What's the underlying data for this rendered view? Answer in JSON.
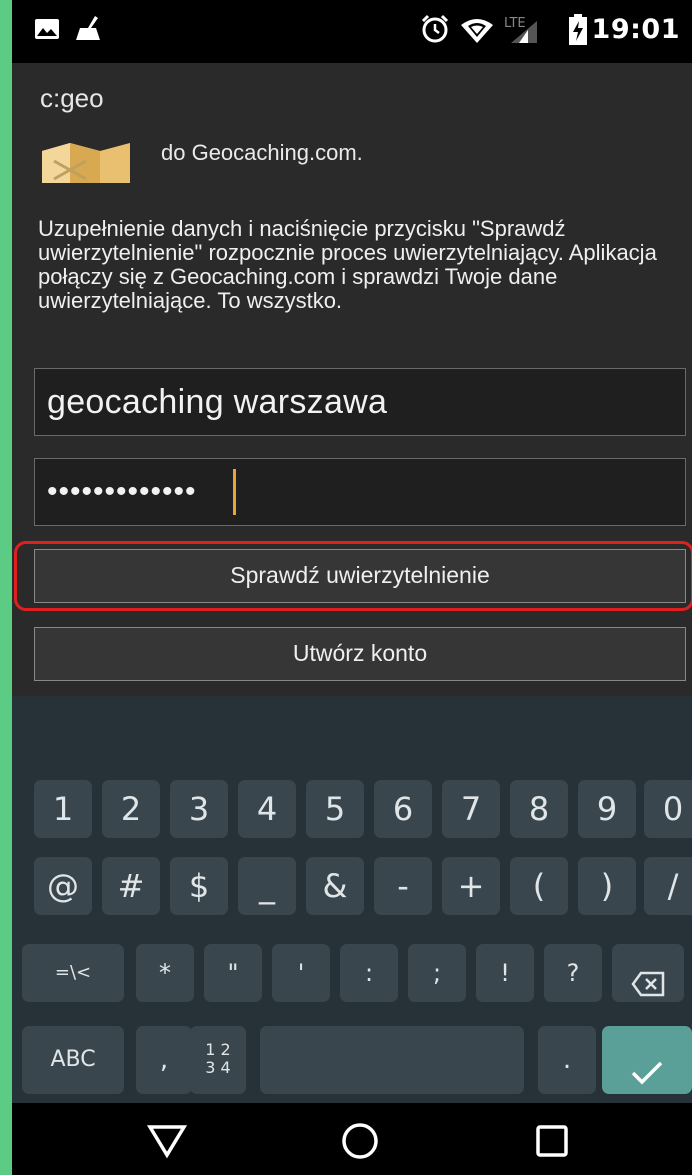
{
  "status_bar": {
    "time": "19:01",
    "network_label": "LTE",
    "left_icons": [
      "image-icon",
      "cleanup-icon"
    ],
    "right_icons": [
      "alarm-icon",
      "wifi-icon",
      "signal-icon",
      "battery-icon"
    ]
  },
  "app_bar": {
    "title": "c:geo"
  },
  "content": {
    "intro_partial": "do Geocaching.com.",
    "info_text": "Uzupełnienie danych i naciśnięcie przycisku \"Sprawdź uwierzytelnienie\" rozpocznie proces uwierzytelniający. Aplikacja połączy się z Geocaching.com i sprawdzi Twoje dane uwierzytelniające. To wszystko.",
    "username_value": "geocaching warszawa",
    "password_masked": "•••••••••••••",
    "verify_button_label": "Sprawdź uwierzytelnienie",
    "create_account_label": "Utwórz konto",
    "highlight_color": "#e02020"
  },
  "keyboard": {
    "row1": [
      "1",
      "2",
      "3",
      "4",
      "5",
      "6",
      "7",
      "8",
      "9",
      "0"
    ],
    "row2": [
      "@",
      "#",
      "$",
      "_",
      "&",
      "-",
      "+",
      "(",
      ")",
      "/"
    ],
    "row3": [
      "=\\<",
      "*",
      "\"",
      "'",
      ":",
      ";",
      "!",
      "?"
    ],
    "row4": {
      "abc": "ABC",
      "comma": ",",
      "numpad_top": "1 2",
      "numpad_bottom": "3 4",
      "period": "."
    },
    "accent_color": "#5a9f98"
  },
  "nav_bar": {
    "icons": [
      "back-icon",
      "home-icon",
      "recents-icon"
    ]
  }
}
